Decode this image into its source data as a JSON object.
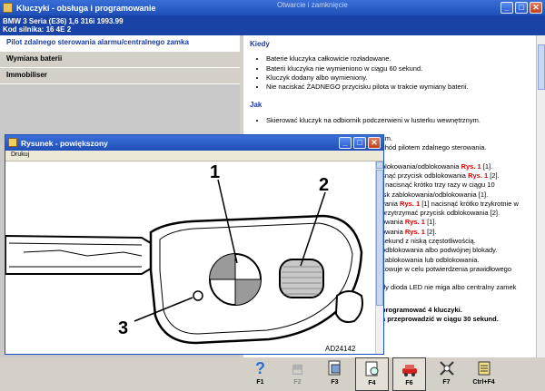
{
  "main_window": {
    "title": "Kluczyki - obsługa i programowanie",
    "ghost_title": "Otwarcie i zamknięcie"
  },
  "vehicle": {
    "line1": "BMW   3 Seria (E36) 1,6 316i 1993.99",
    "line2": "Kod silnika: 16 4E 2"
  },
  "menu": [
    {
      "label": "Pilot zdalnego sterowania alarmu/centralnego zamka",
      "active": true
    },
    {
      "label": "Wymiana baterii",
      "active": false
    },
    {
      "label": "Immobiliser",
      "active": false
    }
  ],
  "content": {
    "kiedy_head": "Kiedy",
    "kiedy_items": [
      "Baterie kluczyka całkowicie rozładowane.",
      "Baterii kluczyka nie wymieniono w ciągu 60 sekund.",
      "Kluczyk dodany albo wymieniony.",
      "Nie naciskać ŻADNEGO przycisku pilota w trakcie wymiany baterii."
    ],
    "jak_head": "Jak",
    "jak_items": [
      "Skierować kluczyk na odbiornik podczerwieni w lusterku wewnętrznym.",
      "cm.",
      "chód pilotem zdalnego sterowania."
    ],
    "partial_lines": [
      "blokowania/odblokowania",
      "snąć przycisk odblokowania",
      "] nacisnąć krótko trzy razy w ciągu 10",
      "isk zablokowania/odblokowania [1].",
      "vania",
      "przytrzymać przycisk odblokowania [2].",
      "owania",
      "owania",
      "sekund z niską częstotliwością.",
      "odblokowania albo podwójnej blokady.",
      "zablokowania lub odblokowania.",
      "kowuje w celu potwierdzenia prawidłowego",
      "dy dioda LED nie miga albo centralny zamek"
    ],
    "rys": "Rys. 1",
    "rys_tails": [
      "[1].",
      "[2].",
      "[1] nacisnąć krótko trzykrotnie w",
      "[1].",
      "[2]."
    ],
    "bold_lines": [
      "programować 4 kluczyki.",
      "a przeprowadzić w ciągu 30 sekund."
    ]
  },
  "popup": {
    "title": "Rysunek - powiększony",
    "menu_item": "Drukuj",
    "figure_labels": [
      "1",
      "2",
      "3"
    ],
    "figure_code": "AD24142"
  },
  "toolbar": [
    {
      "key": "F1",
      "icon": "help-icon",
      "enabled": true
    },
    {
      "key": "F2",
      "icon": "car-icon",
      "enabled": false
    },
    {
      "key": "F3",
      "icon": "document-icon",
      "enabled": true
    },
    {
      "key": "F4",
      "icon": "zoom-document-icon",
      "enabled": true,
      "boxed": true
    },
    {
      "key": "F6",
      "icon": "car-alert-icon",
      "enabled": true,
      "boxed": true
    },
    {
      "key": "F7",
      "icon": "tools-icon",
      "enabled": true
    },
    {
      "key": "Ctrl+F4",
      "icon": "notes-icon",
      "enabled": true
    }
  ]
}
